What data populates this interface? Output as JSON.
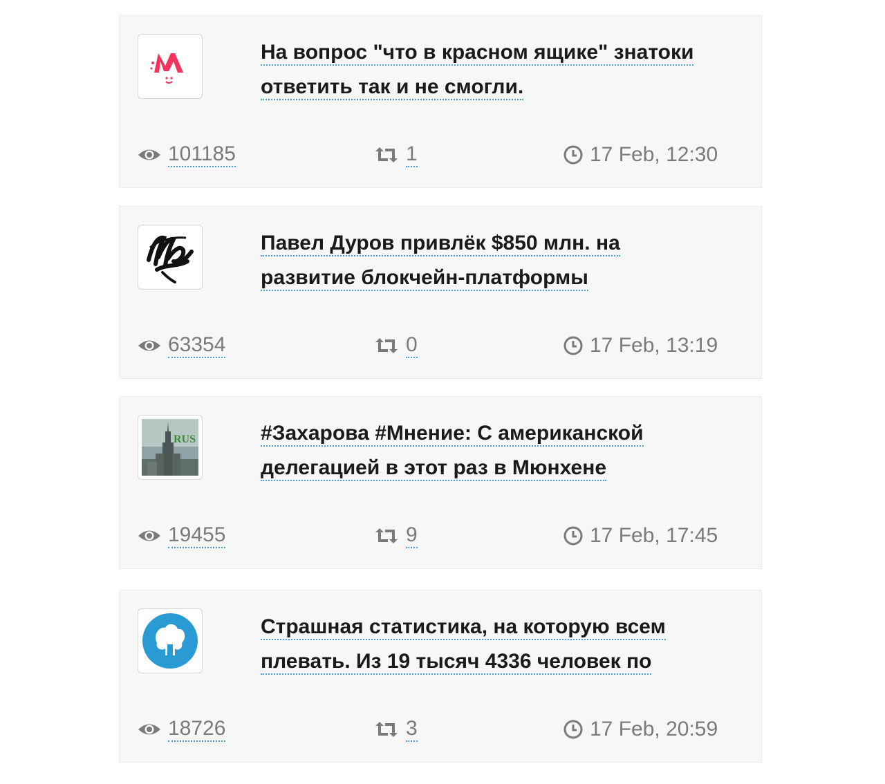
{
  "posts": [
    {
      "avatar": "red-m-logo",
      "title": "На вопрос \"что в красном ящике\" знатоки ответить так и не смогли.",
      "views": "101185",
      "shares": "1",
      "date": "17 Feb, 12:30"
    },
    {
      "avatar": "mash-script-logo",
      "title": "Павел Дуров привлёк $850 млн. на развитие блокчейн-платформы",
      "views": "63354",
      "shares": "0",
      "date": "17 Feb, 13:19"
    },
    {
      "avatar": "mid-building-rus-logo",
      "avatar_label": "RUS",
      "title": "#Захарова #Мнение: С американской делегацией в этот раз в Мюнхене",
      "views": "19455",
      "shares": "9",
      "date": "17 Feb, 17:45"
    },
    {
      "avatar": "blue-circle-logo",
      "title": "Страшная статистика, на которую всем плевать. Из 19 тысяч 4336 человек по",
      "views": "18726",
      "shares": "3",
      "date": "17 Feb, 20:59"
    }
  ],
  "icons": {
    "views": "eye-icon",
    "shares": "retweet-icon",
    "date": "clock-icon"
  },
  "colors": {
    "link_underline": "#4a9fe0",
    "meta_text": "#7a7a7a",
    "card_bg": "#f7f7f7"
  }
}
